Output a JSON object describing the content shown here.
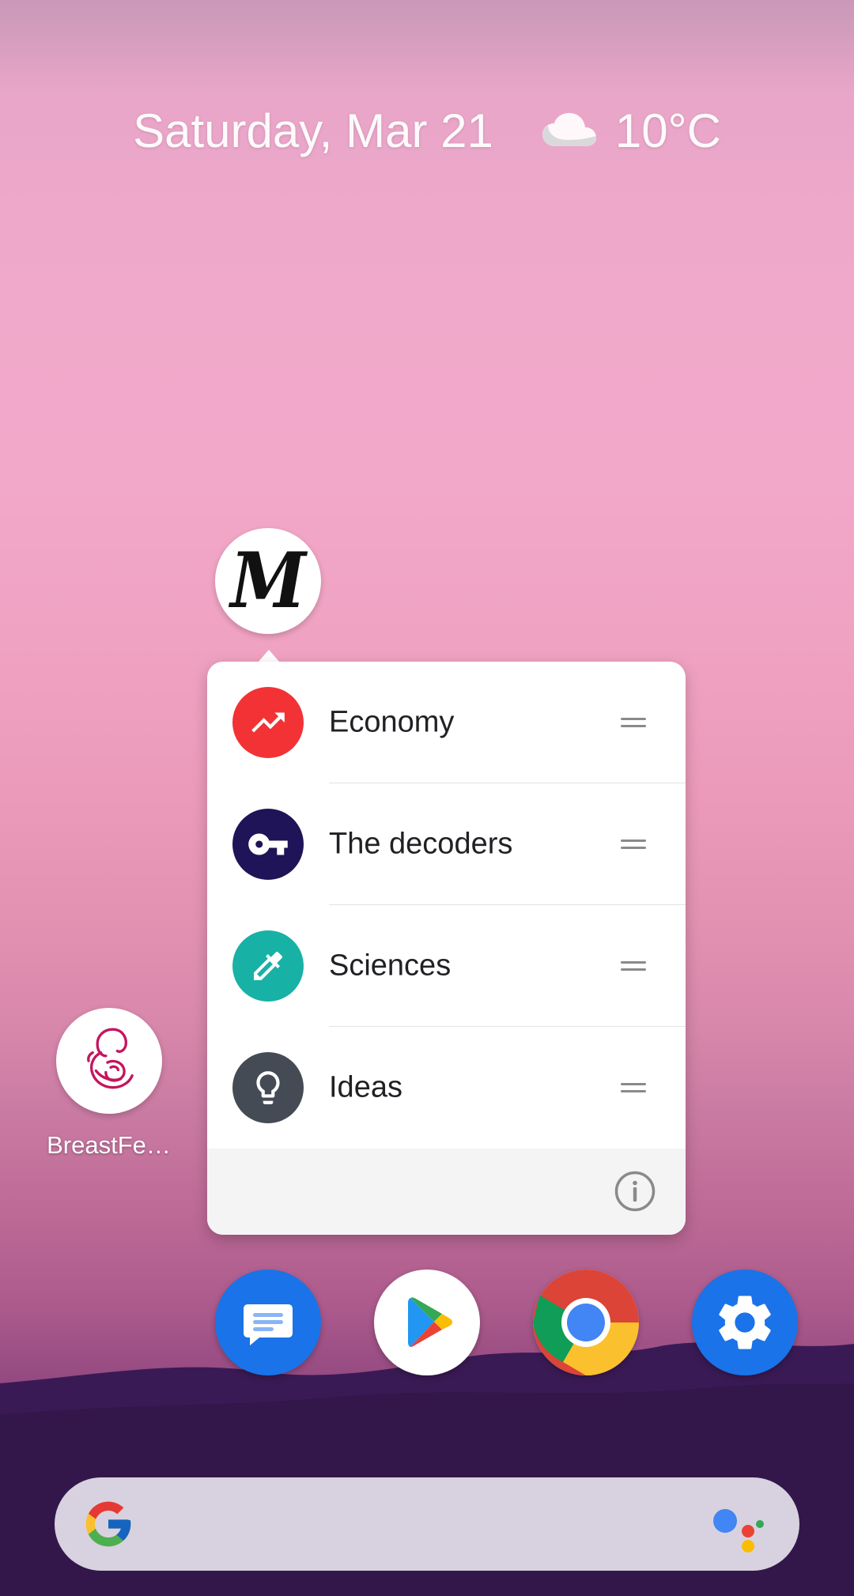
{
  "glance": {
    "date": "Saturday, Mar 21",
    "weather_icon": "cloud-icon",
    "temperature": "10°C"
  },
  "app_icon": {
    "icon": "le-monde-icon",
    "monogram": "M"
  },
  "shortcut_menu": {
    "items": [
      {
        "label": "Economy",
        "icon": "trending-up-icon",
        "color": "#f23235"
      },
      {
        "label": "The decoders",
        "icon": "key-icon",
        "color": "#1e1457"
      },
      {
        "label": "Sciences",
        "icon": "dropper-icon",
        "color": "#17b2a5"
      },
      {
        "label": "Ideas",
        "icon": "lightbulb-icon",
        "color": "#454b54"
      }
    ],
    "footer_icon": "info-icon"
  },
  "home_apps": [
    {
      "label": "BreastFe…",
      "icon": "breastfeeding-icon"
    }
  ],
  "dock": [
    {
      "icon": "messages-icon",
      "color": "#1a73e8"
    },
    {
      "icon": "play-store-icon",
      "color": "#ffffff"
    },
    {
      "icon": "chrome-icon",
      "color": "#ffffff"
    },
    {
      "icon": "settings-icon",
      "color": "#1a73e8"
    }
  ],
  "search_bar": {
    "logo": "google-g-icon",
    "assistant": "assistant-icon"
  }
}
